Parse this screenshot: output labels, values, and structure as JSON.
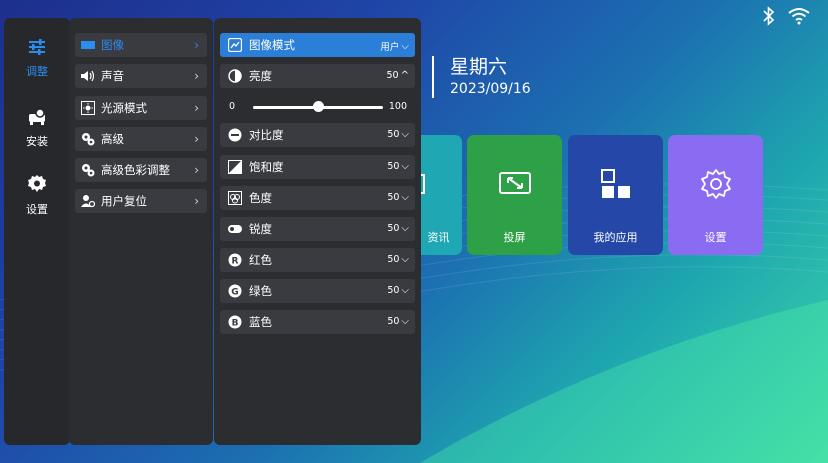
{
  "status": {
    "icons": [
      "bluetooth-icon",
      "wifi-icon"
    ]
  },
  "clock": {
    "weekday": "星期六",
    "date": "2023/09/16"
  },
  "tiles": [
    {
      "label": "资讯",
      "color": "#1fa7b3",
      "icon": "news-icon"
    },
    {
      "label": "投屏",
      "color": "#2ea148",
      "icon": "screen-cast-icon"
    },
    {
      "label": "我的应用",
      "color": "#2548a8",
      "icon": "apps-grid-icon"
    },
    {
      "label": "设置",
      "color": "#8a6cf2",
      "icon": "gear-icon"
    }
  ],
  "nav": [
    {
      "label": "调整",
      "icon": "sliders-icon",
      "active": true
    },
    {
      "label": "安装",
      "icon": "projector-icon",
      "active": false
    },
    {
      "label": "设置",
      "icon": "gear-icon",
      "active": false
    }
  ],
  "menu": [
    {
      "label": "图像",
      "icon": "image-icon",
      "active": true
    },
    {
      "label": "声音",
      "icon": "speaker-icon"
    },
    {
      "label": "光源模式",
      "icon": "light-source-icon"
    },
    {
      "label": "高级",
      "icon": "advanced-icon"
    },
    {
      "label": "高级色彩调整",
      "icon": "color-adjust-icon"
    },
    {
      "label": "用户复位",
      "icon": "user-reset-icon"
    }
  ],
  "settings": {
    "mode": {
      "label": "图像模式",
      "value": "用户",
      "icon": "picture-mode-icon"
    },
    "brightness": {
      "label": "亮度",
      "value": "50",
      "icon": "brightness-icon"
    },
    "slider": {
      "min": "0",
      "max": "100",
      "value": 50
    },
    "rows": [
      {
        "label": "对比度",
        "value": "50",
        "icon": "contrast-icon"
      },
      {
        "label": "饱和度",
        "value": "50",
        "icon": "saturation-icon"
      },
      {
        "label": "色度",
        "value": "50",
        "icon": "hue-icon"
      },
      {
        "label": "锐度",
        "value": "50",
        "icon": "sharpness-icon"
      },
      {
        "label": "红色",
        "value": "50",
        "icon": "red-channel-icon"
      },
      {
        "label": "绿色",
        "value": "50",
        "icon": "green-channel-icon"
      },
      {
        "label": "蓝色",
        "value": "50",
        "icon": "blue-channel-icon"
      }
    ]
  }
}
